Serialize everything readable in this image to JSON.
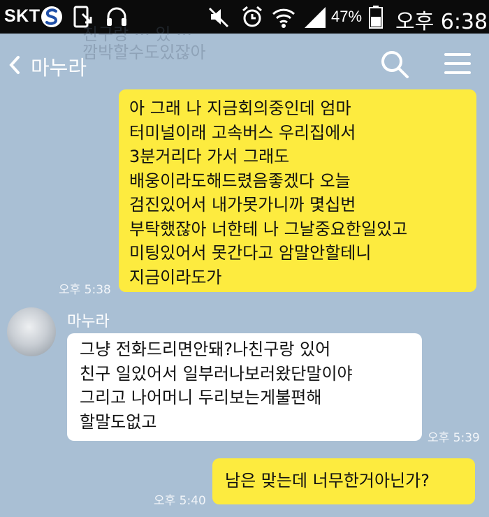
{
  "status_bar": {
    "carrier": "SKT",
    "battery_percent": "47%",
    "clock": "오후 6:38"
  },
  "header": {
    "back_icon": "chevron-left-icon",
    "title": "마누라",
    "ghost_text": "친구랑 ··· 있 ··· \n깜박할수도있잖아",
    "search_icon": "search-icon",
    "menu_icon": "hamburger-menu-icon"
  },
  "messages": [
    {
      "sender": "me",
      "lines": [
        "아 그래 나 지금회의중인데 엄마",
        "터미널이래 고속버스 우리집에서",
        "3분거리다 가서 그래도",
        "배웅이라도해드렸음좋겠다 오늘",
        "검진있어서 내가못가니까 몇십번",
        "부탁했잖아 너한테 나 그날중요한일있고",
        "미팅있어서 못간다고 암말안할테니",
        "지금이라도가"
      ],
      "time": "오후 5:38"
    },
    {
      "sender": "other",
      "name": "마누라",
      "lines": [
        "그냥 전화드리면안돼?나친구랑 있어",
        "친구 일있어서 일부러나보러왔단말이야",
        "그리고 나어머니 두리보는게불편해",
        "할말도없고"
      ],
      "time": "오후 5:39"
    },
    {
      "sender": "me",
      "lines": [
        "남은 맞는데 너무한거아닌가?"
      ],
      "time": "오후 5:40"
    }
  ],
  "colors": {
    "background": "#a9bfd4",
    "my_bubble": "#fdeb3f",
    "other_bubble": "#ffffff",
    "status_bar": "#0b0b0b"
  }
}
